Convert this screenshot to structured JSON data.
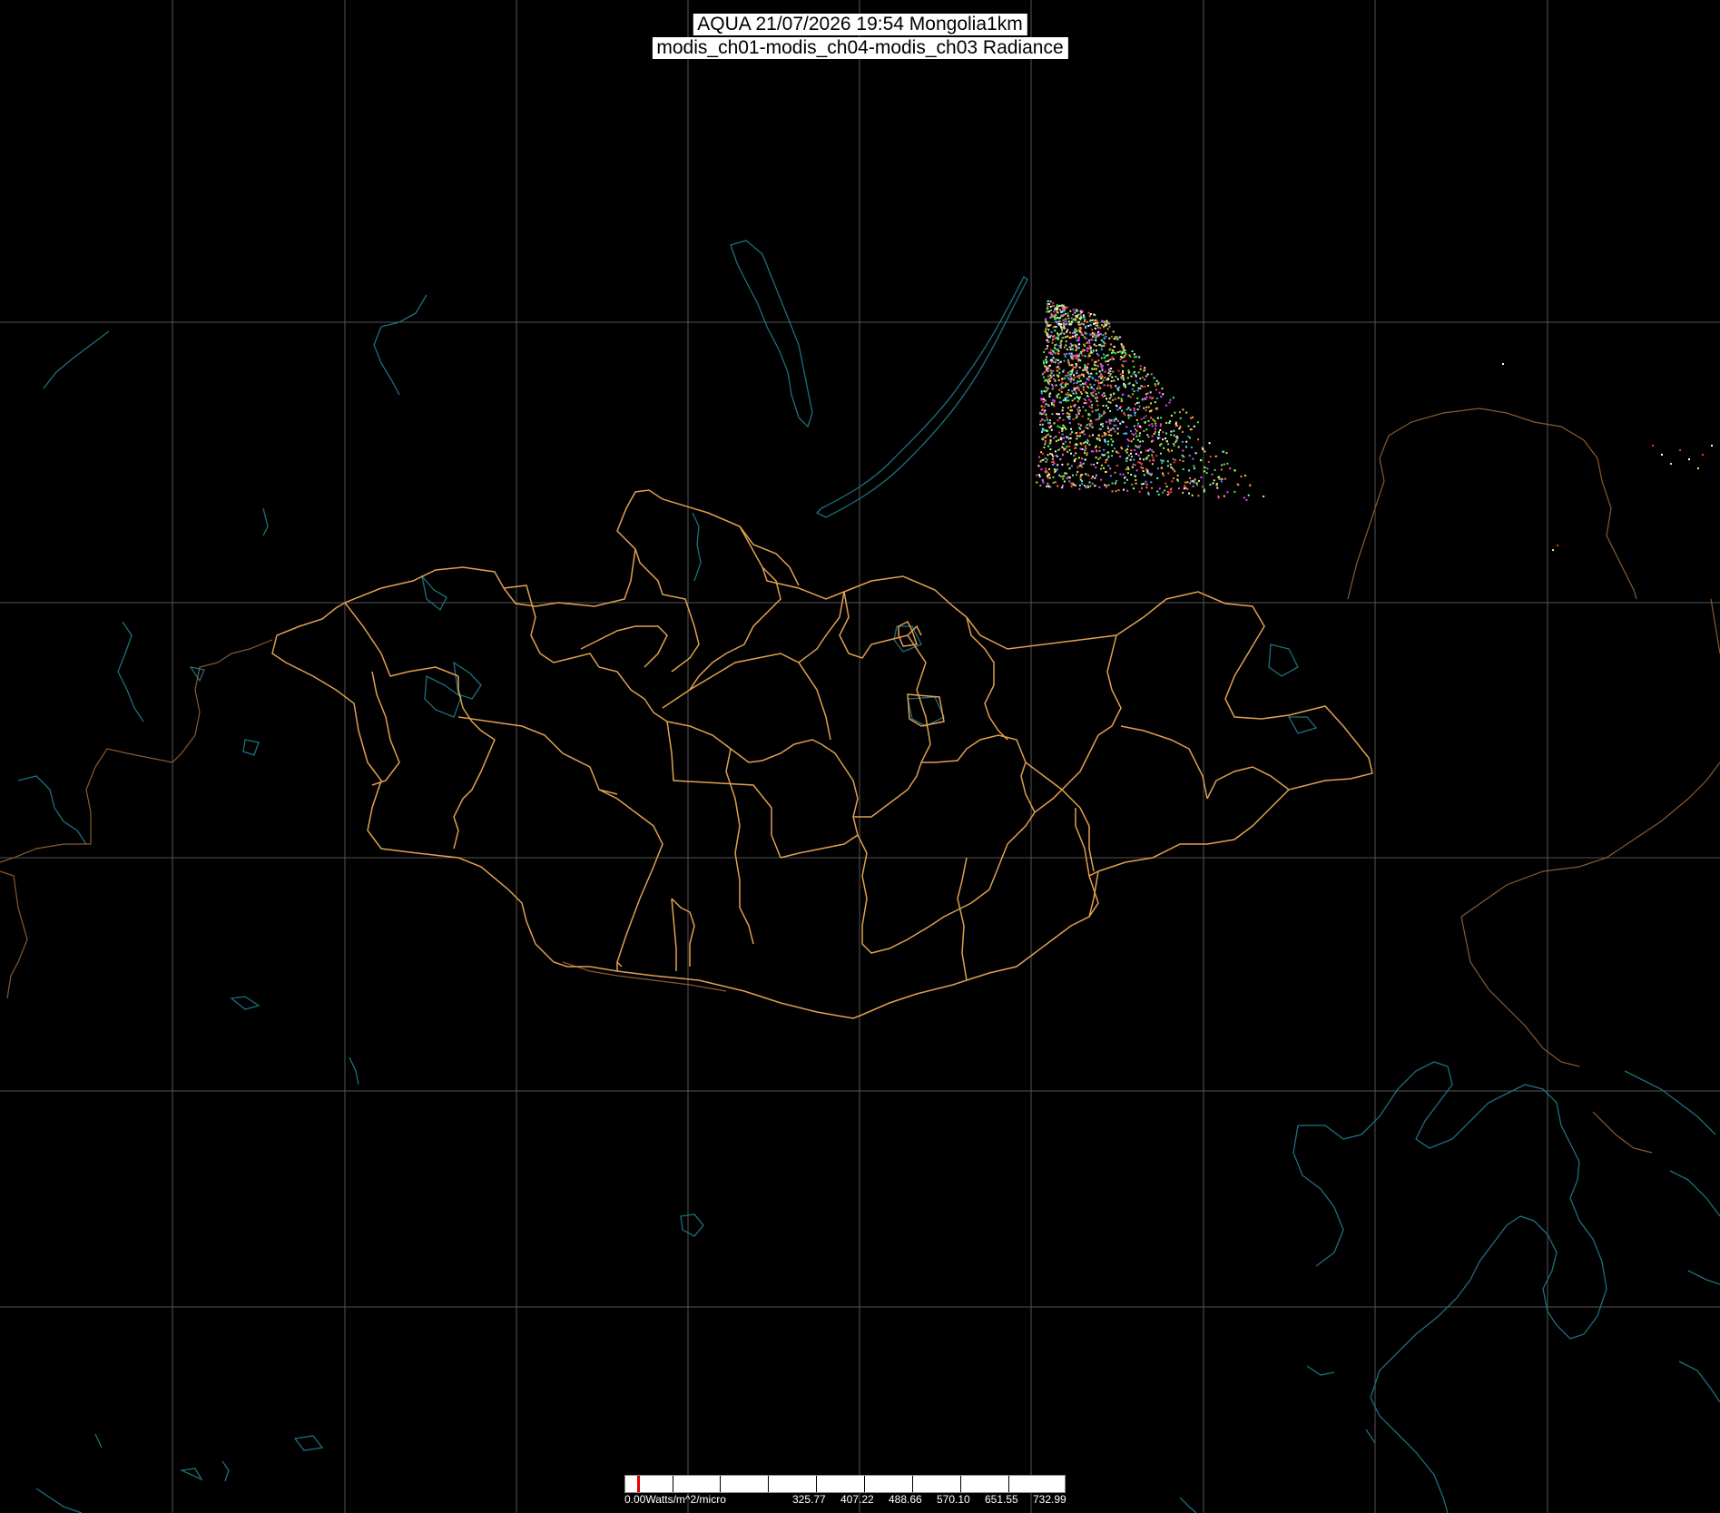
{
  "header": {
    "title_line1": "AQUA 21/07/2026 19:54 Mongolia1km",
    "title_line2": "modis_ch01-modis_ch04-modis_ch03 Radiance"
  },
  "colors": {
    "background": "#000000",
    "grid": "#555555",
    "coastline": "#1f6f80",
    "admin_border": "#e0a050",
    "colorbar_bg": "#ffffff",
    "colorbar_marker": "#e00000"
  },
  "colorbar": {
    "min_label": "0.00Watts/m^2/micro",
    "tick_labels": [
      "325.77",
      "407.22",
      "488.66",
      "570.10",
      "651.55",
      "732.99"
    ]
  }
}
